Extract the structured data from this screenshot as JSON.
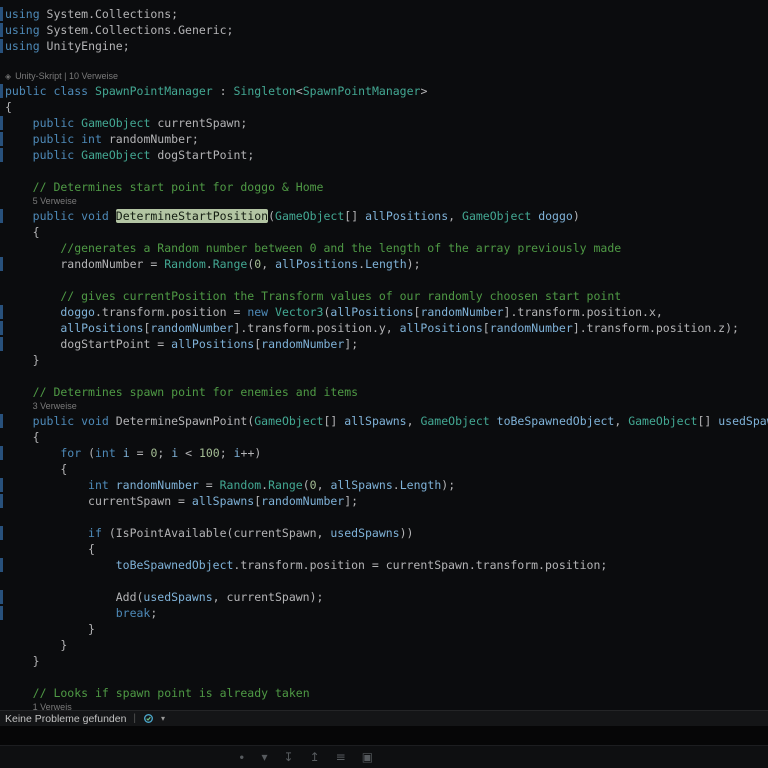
{
  "editor": {
    "background": "#0b0c0e",
    "lens_icon_glyph": "◈",
    "colors": {
      "keyword": "#4e8ab8",
      "type": "#43a893",
      "parameter": "#7fb2d8",
      "plain": "#b4b4b6",
      "comment": "#4f9a45",
      "number": "#a4bd94",
      "codelens": "#7a7a7a",
      "highlight_bg": "#b3c5a3",
      "highlight_fg": "#141d12",
      "change_mark": "#28517c"
    },
    "lines": [
      {
        "t": "code",
        "i": 0,
        "m": 1,
        "tk": [
          [
            "k",
            "using"
          ],
          [
            "n",
            " System.Collections;"
          ]
        ]
      },
      {
        "t": "code",
        "i": 0,
        "m": 1,
        "tk": [
          [
            "k",
            "using"
          ],
          [
            "n",
            " System.Collections.Generic;"
          ]
        ]
      },
      {
        "t": "code",
        "i": 0,
        "m": 1,
        "tk": [
          [
            "k",
            "using"
          ],
          [
            "n",
            " UnityEngine;"
          ]
        ]
      },
      {
        "t": "blank"
      },
      {
        "t": "lens",
        "i": 0,
        "icon": "unity-icon",
        "parts": [
          "Unity-Skript",
          "10 Verweise"
        ]
      },
      {
        "t": "code",
        "i": 0,
        "m": 1,
        "tk": [
          [
            "k",
            "public class "
          ],
          [
            "ty",
            "SpawnPointManager"
          ],
          [
            "n",
            " : "
          ],
          [
            "ty",
            "Singleton"
          ],
          [
            "n",
            "<"
          ],
          [
            "ty",
            "SpawnPointManager"
          ],
          [
            "n",
            ">"
          ]
        ]
      },
      {
        "t": "code",
        "i": 0,
        "tk": [
          [
            "n",
            "{"
          ]
        ]
      },
      {
        "t": "code",
        "i": 1,
        "m": 1,
        "tk": [
          [
            "k",
            "public "
          ],
          [
            "ty",
            "GameObject"
          ],
          [
            "n",
            " currentSpawn;"
          ]
        ]
      },
      {
        "t": "code",
        "i": 1,
        "m": 1,
        "tk": [
          [
            "k",
            "public int"
          ],
          [
            "n",
            " randomNumber;"
          ]
        ]
      },
      {
        "t": "code",
        "i": 1,
        "m": 1,
        "tk": [
          [
            "k",
            "public "
          ],
          [
            "ty",
            "GameObject"
          ],
          [
            "n",
            " dogStartPoint;"
          ]
        ]
      },
      {
        "t": "blank"
      },
      {
        "t": "code",
        "i": 1,
        "tk": [
          [
            "c",
            "// Determines start point for doggo & Home"
          ]
        ]
      },
      {
        "t": "lens",
        "i": 1,
        "parts": [
          "5 Verweise"
        ]
      },
      {
        "t": "code",
        "i": 1,
        "m": 1,
        "tk": [
          [
            "k",
            "public void "
          ],
          [
            "h",
            "DetermineStartPosition"
          ],
          [
            "n",
            "("
          ],
          [
            "ty",
            "GameObject"
          ],
          [
            "n",
            "[] "
          ],
          [
            "p",
            "allPositions"
          ],
          [
            "n",
            ", "
          ],
          [
            "ty",
            "GameObject"
          ],
          [
            "n",
            " "
          ],
          [
            "p",
            "doggo"
          ],
          [
            "n",
            ")"
          ]
        ]
      },
      {
        "t": "code",
        "i": 1,
        "tk": [
          [
            "n",
            "{"
          ]
        ]
      },
      {
        "t": "code",
        "i": 2,
        "tk": [
          [
            "c",
            "//generates a Random number between 0 and the length of the array previously made"
          ]
        ]
      },
      {
        "t": "code",
        "i": 2,
        "m": 1,
        "tk": [
          [
            "n",
            "randomNumber = "
          ],
          [
            "ty",
            "Random"
          ],
          [
            "n",
            "."
          ],
          [
            "ty",
            "Range"
          ],
          [
            "n",
            "("
          ],
          [
            "u",
            "0"
          ],
          [
            "n",
            ", "
          ],
          [
            "p",
            "allPositions"
          ],
          [
            "n",
            "."
          ],
          [
            "p",
            "Length"
          ],
          [
            "n",
            ");"
          ]
        ]
      },
      {
        "t": "blank"
      },
      {
        "t": "code",
        "i": 2,
        "tk": [
          [
            "c",
            "// gives currentPosition the Transform values of our randomly choosen start point"
          ]
        ]
      },
      {
        "t": "code",
        "i": 2,
        "m": 1,
        "tk": [
          [
            "p",
            "doggo"
          ],
          [
            "n",
            ".transform.position = "
          ],
          [
            "k",
            "new "
          ],
          [
            "ty",
            "Vector3"
          ],
          [
            "n",
            "("
          ],
          [
            "p",
            "allPositions"
          ],
          [
            "n",
            "["
          ],
          [
            "p",
            "randomNumber"
          ],
          [
            "n",
            "].transform.position.x,"
          ]
        ]
      },
      {
        "t": "code",
        "i": 2,
        "m": 1,
        "tk": [
          [
            "p",
            "allPositions"
          ],
          [
            "n",
            "["
          ],
          [
            "p",
            "randomNumber"
          ],
          [
            "n",
            "].transform.position.y, "
          ],
          [
            "p",
            "allPositions"
          ],
          [
            "n",
            "["
          ],
          [
            "p",
            "randomNumber"
          ],
          [
            "n",
            "].transform.position.z);"
          ]
        ]
      },
      {
        "t": "code",
        "i": 2,
        "m": 1,
        "tk": [
          [
            "n",
            "dogStartPoint = "
          ],
          [
            "p",
            "allPositions"
          ],
          [
            "n",
            "["
          ],
          [
            "p",
            "randomNumber"
          ],
          [
            "n",
            "];"
          ]
        ]
      },
      {
        "t": "code",
        "i": 1,
        "tk": [
          [
            "n",
            "}"
          ]
        ]
      },
      {
        "t": "blank"
      },
      {
        "t": "code",
        "i": 1,
        "tk": [
          [
            "c",
            "// Determines spawn point for enemies and items"
          ]
        ]
      },
      {
        "t": "lens",
        "i": 1,
        "parts": [
          "3 Verweise"
        ]
      },
      {
        "t": "code",
        "i": 1,
        "m": 1,
        "tk": [
          [
            "k",
            "public void "
          ],
          [
            "n",
            "DetermineSpawnPoint("
          ],
          [
            "ty",
            "GameObject"
          ],
          [
            "n",
            "[] "
          ],
          [
            "p",
            "allSpawns"
          ],
          [
            "n",
            ", "
          ],
          [
            "ty",
            "GameObject"
          ],
          [
            "n",
            " "
          ],
          [
            "p",
            "toBeSpawnedObject"
          ],
          [
            "n",
            ", "
          ],
          [
            "ty",
            "GameObject"
          ],
          [
            "n",
            "[] "
          ],
          [
            "p",
            "usedSpawns"
          ],
          [
            "n",
            ")"
          ]
        ]
      },
      {
        "t": "code",
        "i": 1,
        "tk": [
          [
            "n",
            "{"
          ]
        ]
      },
      {
        "t": "code",
        "i": 2,
        "m": 1,
        "tk": [
          [
            "k",
            "for"
          ],
          [
            "n",
            " ("
          ],
          [
            "k",
            "int"
          ],
          [
            "n",
            " "
          ],
          [
            "p",
            "i"
          ],
          [
            "n",
            " = "
          ],
          [
            "u",
            "0"
          ],
          [
            "n",
            "; "
          ],
          [
            "p",
            "i"
          ],
          [
            "n",
            " < "
          ],
          [
            "u",
            "100"
          ],
          [
            "n",
            "; "
          ],
          [
            "p",
            "i"
          ],
          [
            "n",
            "++)"
          ]
        ]
      },
      {
        "t": "code",
        "i": 2,
        "tk": [
          [
            "n",
            "{"
          ]
        ]
      },
      {
        "t": "code",
        "i": 3,
        "m": 1,
        "tk": [
          [
            "k",
            "int"
          ],
          [
            "n",
            " "
          ],
          [
            "p",
            "randomNumber"
          ],
          [
            "n",
            " = "
          ],
          [
            "ty",
            "Random"
          ],
          [
            "n",
            "."
          ],
          [
            "ty",
            "Range"
          ],
          [
            "n",
            "("
          ],
          [
            "u",
            "0"
          ],
          [
            "n",
            ", "
          ],
          [
            "p",
            "allSpawns"
          ],
          [
            "n",
            "."
          ],
          [
            "p",
            "Length"
          ],
          [
            "n",
            ");"
          ]
        ]
      },
      {
        "t": "code",
        "i": 3,
        "m": 1,
        "tk": [
          [
            "n",
            "currentSpawn = "
          ],
          [
            "p",
            "allSpawns"
          ],
          [
            "n",
            "["
          ],
          [
            "p",
            "randomNumber"
          ],
          [
            "n",
            "];"
          ]
        ]
      },
      {
        "t": "blank"
      },
      {
        "t": "code",
        "i": 3,
        "m": 1,
        "tk": [
          [
            "k",
            "if"
          ],
          [
            "n",
            " (IsPointAvailable(currentSpawn, "
          ],
          [
            "p",
            "usedSpawns"
          ],
          [
            "n",
            "))"
          ]
        ]
      },
      {
        "t": "code",
        "i": 3,
        "tk": [
          [
            "n",
            "{"
          ]
        ]
      },
      {
        "t": "code",
        "i": 4,
        "m": 1,
        "tk": [
          [
            "p",
            "toBeSpawnedObject"
          ],
          [
            "n",
            ".transform.position = currentSpawn.transform.position;"
          ]
        ]
      },
      {
        "t": "blank"
      },
      {
        "t": "code",
        "i": 4,
        "m": 1,
        "tk": [
          [
            "n",
            "Add("
          ],
          [
            "p",
            "usedSpawns"
          ],
          [
            "n",
            ", currentSpawn);"
          ]
        ]
      },
      {
        "t": "code",
        "i": 4,
        "m": 1,
        "tk": [
          [
            "k",
            "break"
          ],
          [
            "n",
            ";"
          ]
        ]
      },
      {
        "t": "code",
        "i": 3,
        "tk": [
          [
            "n",
            "}"
          ]
        ]
      },
      {
        "t": "code",
        "i": 2,
        "tk": [
          [
            "n",
            "}"
          ]
        ]
      },
      {
        "t": "code",
        "i": 1,
        "tk": [
          [
            "n",
            "}"
          ]
        ]
      },
      {
        "t": "blank"
      },
      {
        "t": "code",
        "i": 1,
        "tk": [
          [
            "c",
            "// Looks if spawn point is already taken"
          ]
        ]
      },
      {
        "t": "lens",
        "i": 1,
        "parts": [
          "1 Verweis"
        ]
      }
    ]
  },
  "status_bar": {
    "message": "Keine Probleme gefunden",
    "separator": "|",
    "caret": "▾",
    "health_color": "#4aa3c7"
  },
  "bottom_toolbar": {
    "icons": [
      {
        "name": "more-dot-icon",
        "glyph": "∙"
      },
      {
        "name": "chevron-down-icon",
        "glyph": "▾"
      },
      {
        "name": "step-into-icon",
        "glyph": "↧"
      },
      {
        "name": "step-out-icon",
        "glyph": "↥"
      },
      {
        "name": "list-icon",
        "glyph": "≡"
      },
      {
        "name": "open-window-icon",
        "glyph": "▣"
      }
    ]
  }
}
